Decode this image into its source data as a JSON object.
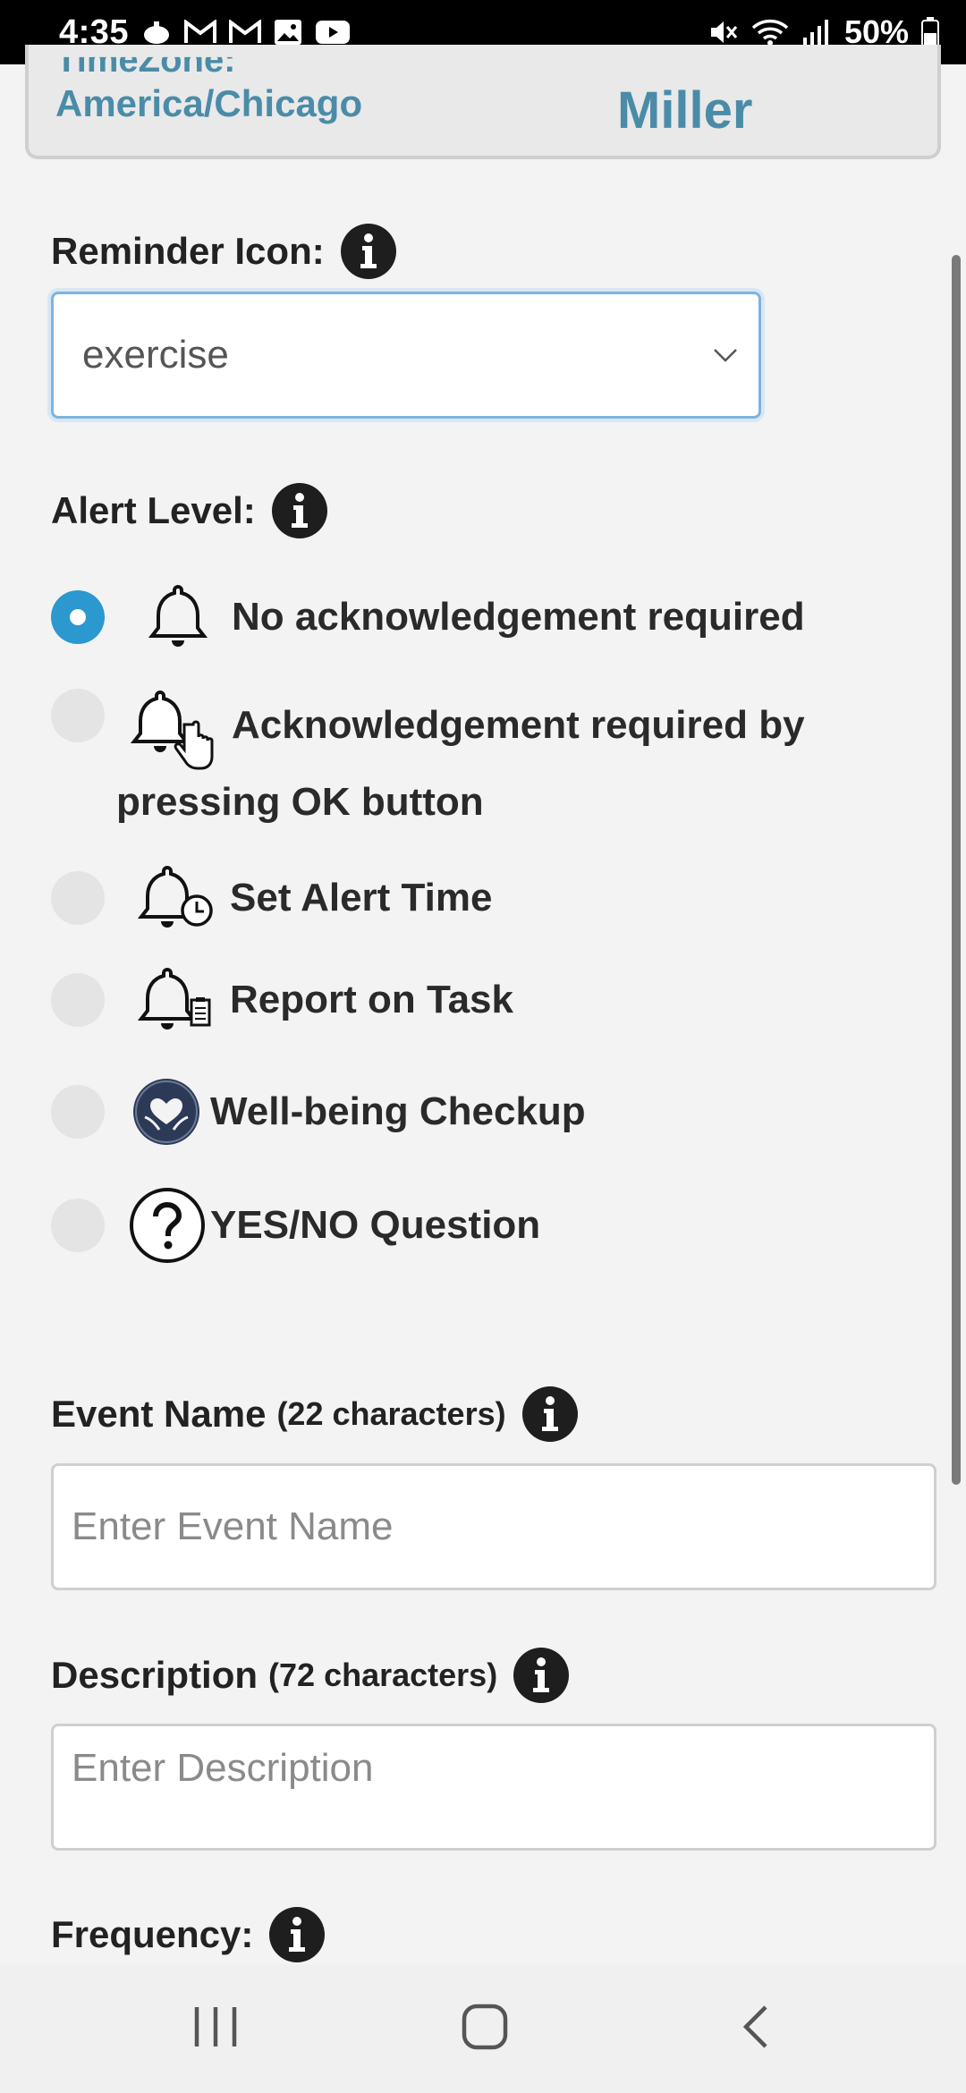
{
  "status_bar": {
    "time": "4:35",
    "battery": "50%"
  },
  "top_card": {
    "timezone_label": "TimeZone:",
    "timezone_value": "America/Chicago",
    "surname": "Miller"
  },
  "reminder_icon": {
    "label": "Reminder Icon:",
    "selected": "exercise"
  },
  "alert_level": {
    "label": "Alert Level:",
    "options": [
      {
        "label": "No acknowledgement required",
        "checked": true,
        "icon": "bell-icon"
      },
      {
        "label_line1": "Acknowledgement required by",
        "label_line2": "pressing OK button",
        "checked": false,
        "icon": "bell-hand-icon"
      },
      {
        "label": "Set Alert Time",
        "checked": false,
        "icon": "bell-clock-icon"
      },
      {
        "label": "Report on Task",
        "checked": false,
        "icon": "bell-clipboard-icon"
      },
      {
        "label": "Well-being Checkup",
        "checked": false,
        "icon": "heart-hands-icon"
      },
      {
        "label": "YES/NO Question",
        "checked": false,
        "icon": "question-circle-icon"
      }
    ]
  },
  "event_name": {
    "label": "Event Name",
    "hint": "(22 characters)",
    "placeholder": "Enter Event Name"
  },
  "description": {
    "label": "Description",
    "hint": "(72 characters)",
    "placeholder": "Enter Description"
  },
  "frequency": {
    "label": "Frequency:"
  },
  "colors": {
    "accent": "#2b98cf",
    "heading_blue": "#4a8ca8"
  }
}
